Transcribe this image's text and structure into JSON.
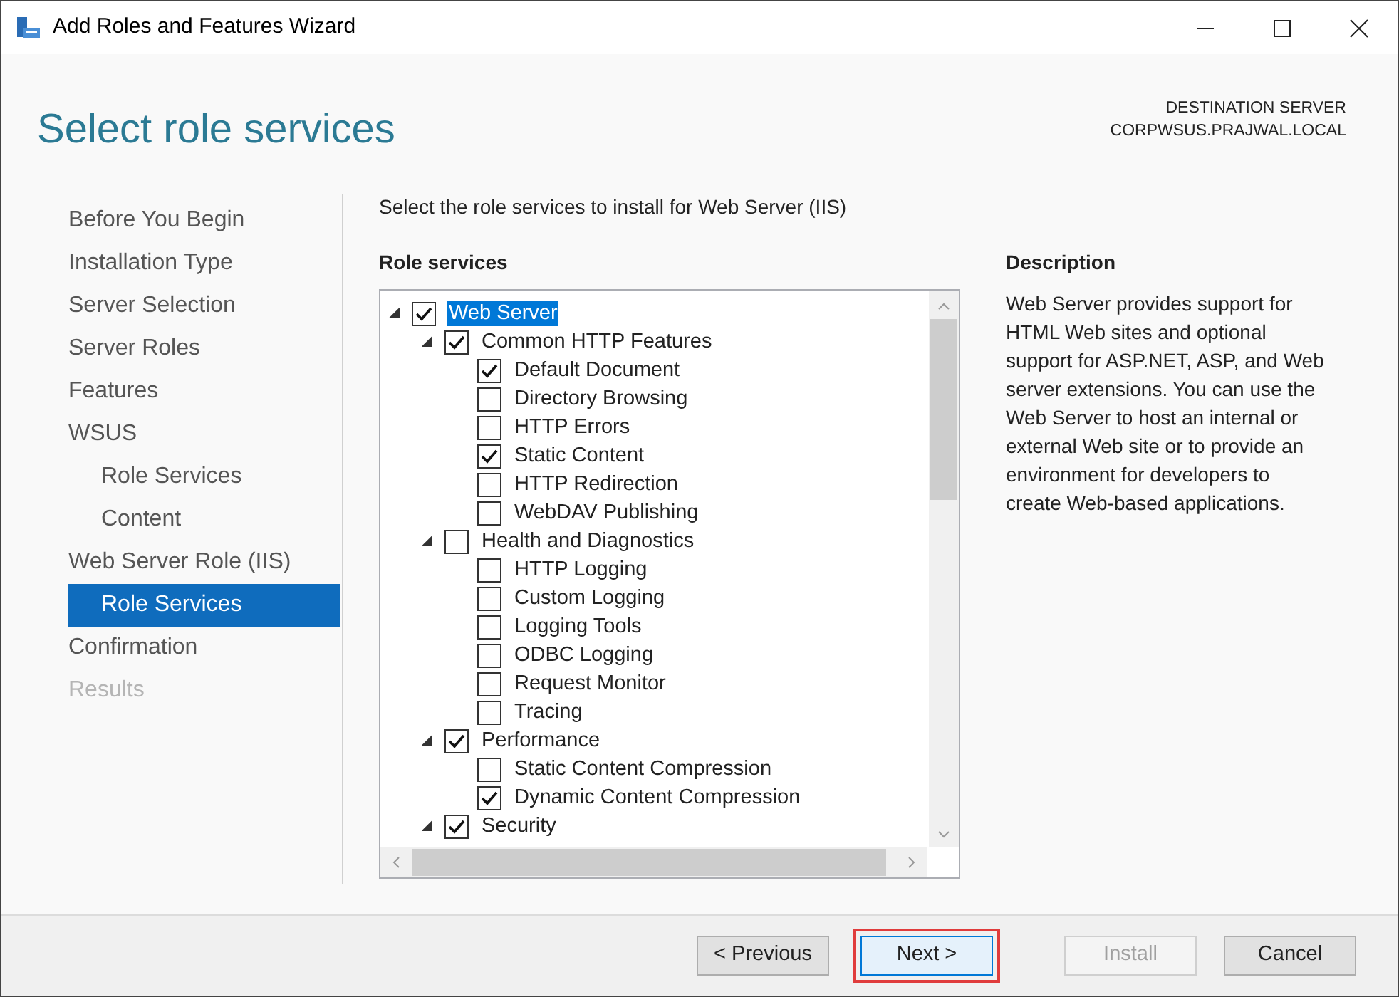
{
  "window": {
    "title": "Add Roles and Features Wizard"
  },
  "header": {
    "title": "Select role services",
    "destination_label": "DESTINATION SERVER",
    "destination_server": "CORPWSUS.PRAJWAL.LOCAL"
  },
  "nav": [
    {
      "label": "Before You Begin",
      "selected": false,
      "disabled": false
    },
    {
      "label": "Installation Type",
      "selected": false,
      "disabled": false
    },
    {
      "label": "Server Selection",
      "selected": false,
      "disabled": false
    },
    {
      "label": "Server Roles",
      "selected": false,
      "disabled": false
    },
    {
      "label": "Features",
      "selected": false,
      "disabled": false
    },
    {
      "label": "WSUS",
      "selected": false,
      "disabled": false,
      "children": [
        {
          "label": "Role Services",
          "selected": false,
          "disabled": false
        },
        {
          "label": "Content",
          "selected": false,
          "disabled": false
        }
      ]
    },
    {
      "label": "Web Server Role (IIS)",
      "selected": false,
      "disabled": false,
      "children": [
        {
          "label": "Role Services",
          "selected": true,
          "disabled": false
        }
      ]
    },
    {
      "label": "Confirmation",
      "selected": false,
      "disabled": false
    },
    {
      "label": "Results",
      "selected": false,
      "disabled": true
    }
  ],
  "intro": "Select the role services to install for Web Server (IIS)",
  "role_services": {
    "heading": "Role services",
    "tree": [
      {
        "label": "Web Server",
        "checked": true,
        "selected": true,
        "expanded": true,
        "children": [
          {
            "label": "Common HTTP Features",
            "checked": true,
            "selected": false,
            "expanded": true,
            "children": [
              {
                "label": "Default Document",
                "checked": true,
                "selected": false
              },
              {
                "label": "Directory Browsing",
                "checked": false,
                "selected": false
              },
              {
                "label": "HTTP Errors",
                "checked": false,
                "selected": false
              },
              {
                "label": "Static Content",
                "checked": true,
                "selected": false
              },
              {
                "label": "HTTP Redirection",
                "checked": false,
                "selected": false
              },
              {
                "label": "WebDAV Publishing",
                "checked": false,
                "selected": false
              }
            ]
          },
          {
            "label": "Health and Diagnostics",
            "checked": false,
            "selected": false,
            "expanded": true,
            "children": [
              {
                "label": "HTTP Logging",
                "checked": false,
                "selected": false
              },
              {
                "label": "Custom Logging",
                "checked": false,
                "selected": false
              },
              {
                "label": "Logging Tools",
                "checked": false,
                "selected": false
              },
              {
                "label": "ODBC Logging",
                "checked": false,
                "selected": false
              },
              {
                "label": "Request Monitor",
                "checked": false,
                "selected": false
              },
              {
                "label": "Tracing",
                "checked": false,
                "selected": false
              }
            ]
          },
          {
            "label": "Performance",
            "checked": true,
            "selected": false,
            "expanded": true,
            "children": [
              {
                "label": "Static Content Compression",
                "checked": false,
                "selected": false
              },
              {
                "label": "Dynamic Content Compression",
                "checked": true,
                "selected": false
              }
            ]
          },
          {
            "label": "Security",
            "checked": true,
            "selected": false,
            "expanded": true
          }
        ]
      }
    ]
  },
  "description": {
    "heading": "Description",
    "text": "Web Server provides support for HTML Web sites and optional support for ASP.NET, ASP, and Web server extensions. You can use the Web Server to host an internal or external Web site or to provide an environment for developers to create Web-based applications."
  },
  "buttons": [
    {
      "label": "< Previous",
      "disabled": false,
      "highlighted": false
    },
    {
      "label": "Next >",
      "disabled": false,
      "highlighted": true
    },
    {
      "label": "Install",
      "disabled": true,
      "highlighted": false
    },
    {
      "label": "Cancel",
      "disabled": false,
      "highlighted": false
    }
  ]
}
